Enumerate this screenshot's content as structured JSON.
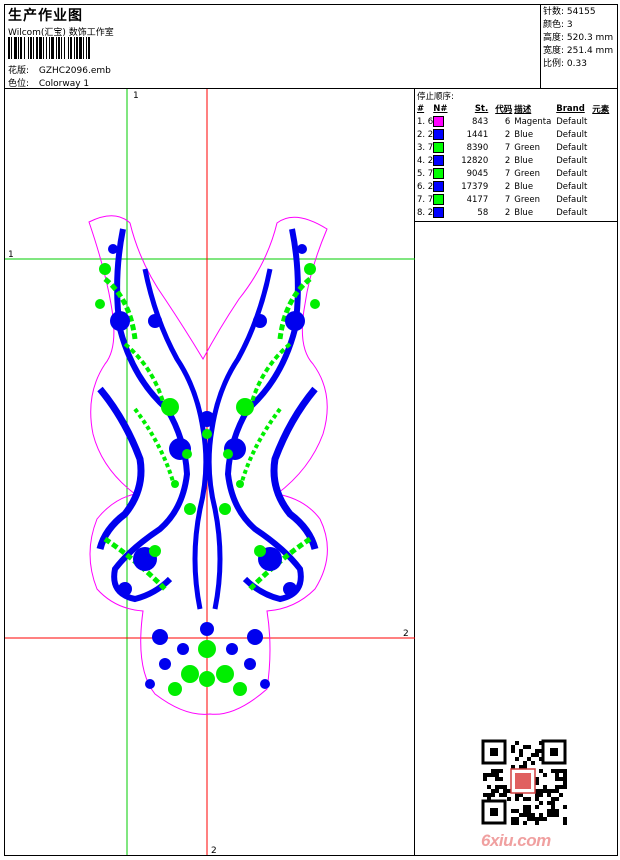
{
  "header": {
    "title": "生产作业图",
    "company": "Wilcom(汇宝) 数饰工作室",
    "design_label": "花版:",
    "design_value": "GZHC2096.emb",
    "colorway_label": "色位:",
    "colorway_value": "Colorway 1"
  },
  "stats": [
    {
      "label": "针数:",
      "value": "54155"
    },
    {
      "label": "颜色:",
      "value": "3"
    },
    {
      "label": "高度:",
      "value": "520.3 mm"
    },
    {
      "label": "宽度:",
      "value": "251.4 mm"
    },
    {
      "label": "比例:",
      "value": "0.33"
    }
  ],
  "sequence": {
    "title": "停止顺序:",
    "headers": [
      "#",
      "N#",
      "St.",
      "代码",
      "描述",
      "Brand",
      "元素"
    ],
    "rows": [
      {
        "idx": "1. 6",
        "color": "#ff00ff",
        "stitches": "843",
        "code": "6",
        "desc": "Magenta",
        "brand": "Default"
      },
      {
        "idx": "2. 2",
        "color": "#0000ff",
        "stitches": "1441",
        "code": "2",
        "desc": "Blue",
        "brand": "Default"
      },
      {
        "idx": "3. 7",
        "color": "#00ff00",
        "stitches": "8390",
        "code": "7",
        "desc": "Green",
        "brand": "Default"
      },
      {
        "idx": "4. 2",
        "color": "#0000ff",
        "stitches": "12820",
        "code": "2",
        "desc": "Blue",
        "brand": "Default"
      },
      {
        "idx": "5. 7",
        "color": "#00ff00",
        "stitches": "9045",
        "code": "7",
        "desc": "Green",
        "brand": "Default"
      },
      {
        "idx": "6. 2",
        "color": "#0000ff",
        "stitches": "17379",
        "code": "2",
        "desc": "Blue",
        "brand": "Default"
      },
      {
        "idx": "7. 7",
        "color": "#00ff00",
        "stitches": "4177",
        "code": "7",
        "desc": "Green",
        "brand": "Default"
      },
      {
        "idx": "8. 2",
        "color": "#0000ff",
        "stitches": "58",
        "code": "2",
        "desc": "Blue",
        "brand": "Default"
      }
    ]
  },
  "guides": {
    "v1": "1",
    "h1": "1",
    "h2": "2",
    "v2": "2",
    "green": "#00cc00",
    "red": "#ff0000"
  },
  "watermark": {
    "logo_text": "6xiu.com",
    "icon": "qr-code-icon"
  }
}
